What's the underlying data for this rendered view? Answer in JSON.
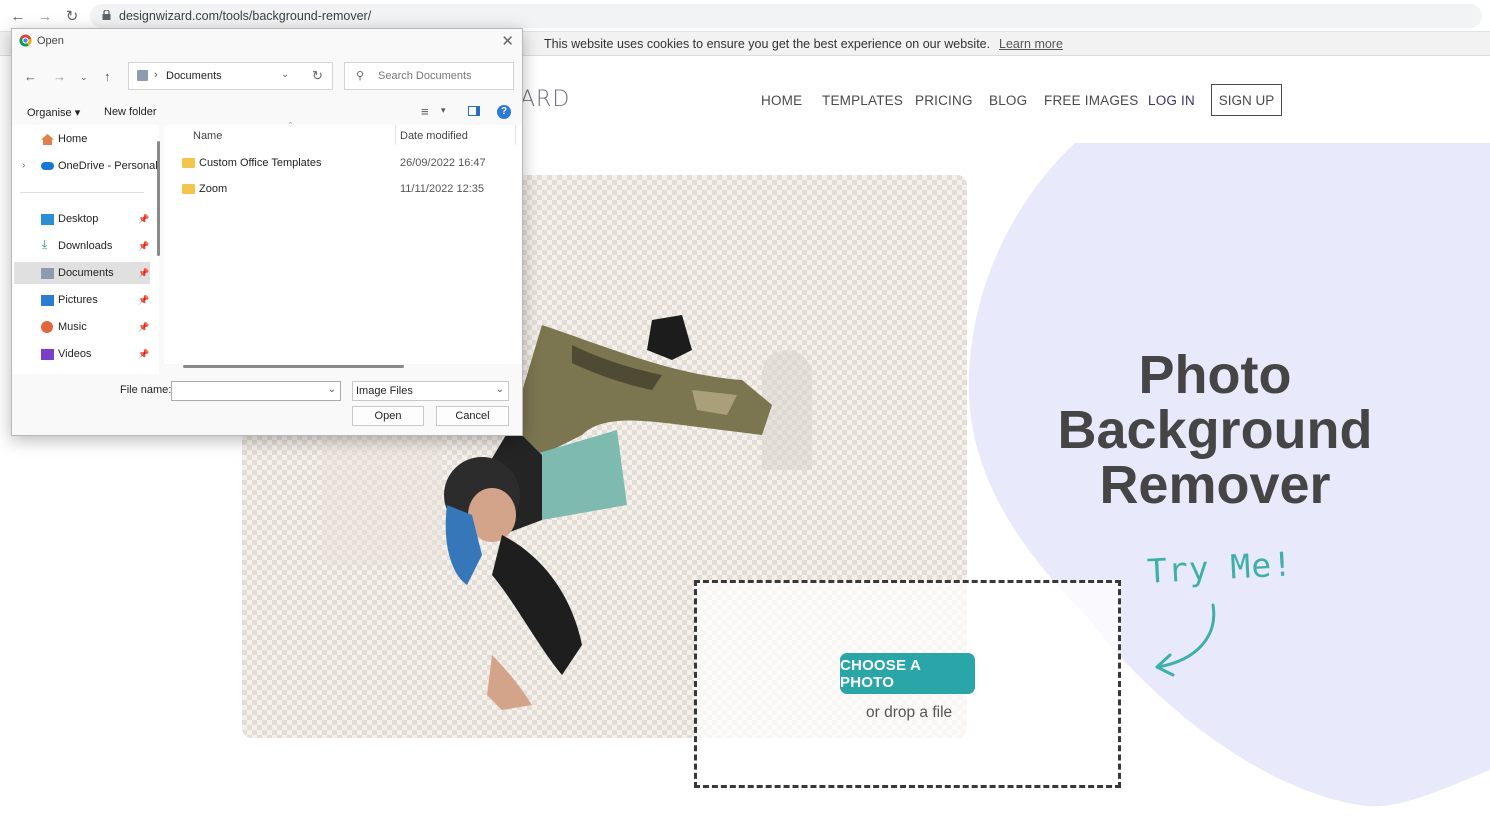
{
  "browser": {
    "url": "designwizard.com/tools/background-remover/"
  },
  "cookie_bar": {
    "text": "This website uses cookies to ensure you get the best experience on our website.",
    "link": "Learn more"
  },
  "site": {
    "logo_fragment": "ARD",
    "nav": [
      "HOME",
      "TEMPLATES",
      "PRICING",
      "BLOG",
      "FREE IMAGES",
      "LOG IN"
    ],
    "signup": "SIGN UP"
  },
  "hero": {
    "title_line1": "Photo",
    "title_line2": "Background",
    "title_line3": "Remover",
    "try_me": "Try Me!",
    "choose_button": "CHOOSE A PHOTO",
    "drop_text": "or drop a file"
  },
  "dialog": {
    "title": "Open",
    "address": "Documents",
    "search_placeholder": "Search Documents",
    "organise": "Organise ▾",
    "new_folder": "New folder",
    "nav_items": [
      "Home",
      "OneDrive - Personal",
      "Desktop",
      "Downloads",
      "Documents",
      "Pictures",
      "Music",
      "Videos"
    ],
    "columns": [
      "Name",
      "Date modified"
    ],
    "files": [
      {
        "name": "Custom Office Templates",
        "date": "26/09/2022 16:47"
      },
      {
        "name": "Zoom",
        "date": "11/11/2022 12:35"
      }
    ],
    "file_name_label": "File name:",
    "file_name_value": "",
    "file_type": "Image Files",
    "open_button": "Open",
    "cancel_button": "Cancel"
  },
  "colors": {
    "accent_teal": "#2aa6a8",
    "blob": "#e9e9fc",
    "title": "#454545"
  }
}
